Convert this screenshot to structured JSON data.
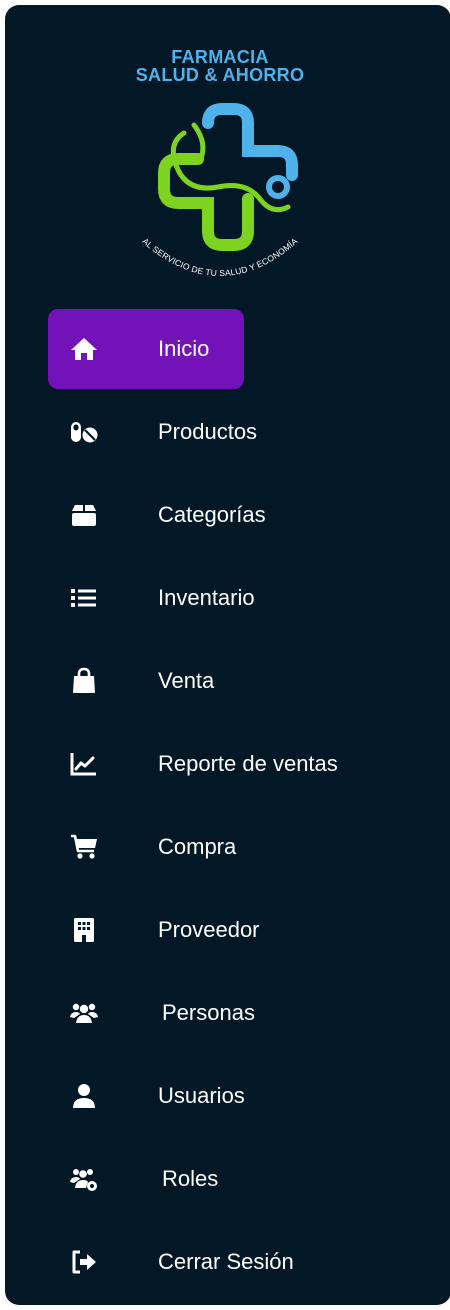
{
  "brand": {
    "line1": "FARMACIA",
    "line2": "SALUD & AHORRO",
    "tagline": "AL SERVICIO DE TU SALUD Y ECONOMÍA"
  },
  "colors": {
    "sidebar_bg": "#031826",
    "active_bg": "#7212b8",
    "text": "#ffffff",
    "brand_blue": "#4fb2ea",
    "brand_green": "#7ed321"
  },
  "nav": {
    "items": [
      {
        "label": "Inicio",
        "icon": "home-icon",
        "active": true
      },
      {
        "label": "Productos",
        "icon": "pills-icon"
      },
      {
        "label": "Categorías",
        "icon": "box-icon"
      },
      {
        "label": "Inventario",
        "icon": "list-icon"
      },
      {
        "label": "Venta",
        "icon": "shopping-bag-icon"
      },
      {
        "label": "Reporte de ventas",
        "icon": "chart-line-icon"
      },
      {
        "label": "Compra",
        "icon": "shopping-cart-icon"
      },
      {
        "label": "Proveedor",
        "icon": "building-icon"
      },
      {
        "label": "Personas",
        "icon": "users-icon"
      },
      {
        "label": "Usuarios",
        "icon": "user-icon"
      },
      {
        "label": "Roles",
        "icon": "users-gear-icon"
      },
      {
        "label": "Cerrar Sesión",
        "icon": "sign-out-icon"
      }
    ]
  }
}
